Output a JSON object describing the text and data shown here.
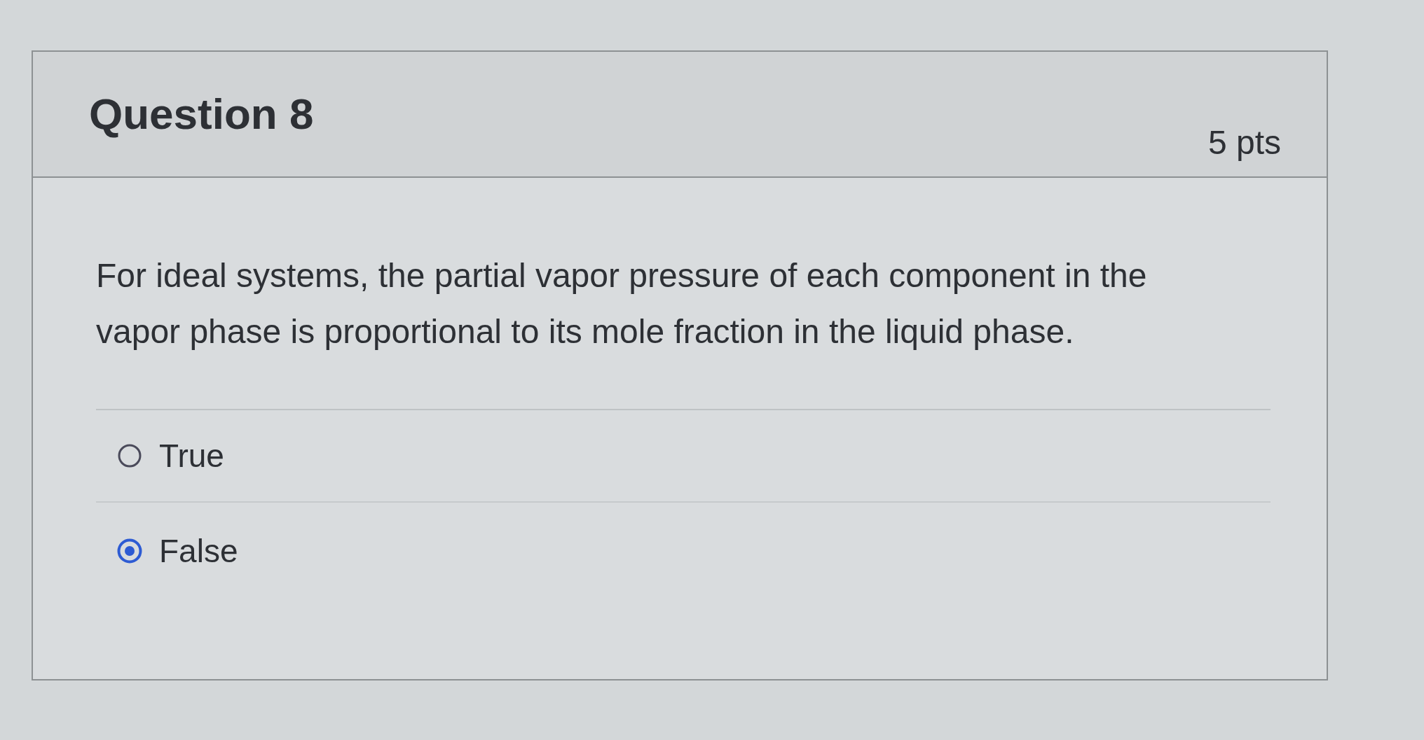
{
  "question": {
    "title": "Question 8",
    "points": "5 pts",
    "text": "For ideal systems, the partial vapor pressure of each component in the vapor phase is proportional to its mole fraction in the liquid phase.",
    "answers": [
      {
        "label": "True",
        "selected": false
      },
      {
        "label": "False",
        "selected": true
      }
    ]
  }
}
